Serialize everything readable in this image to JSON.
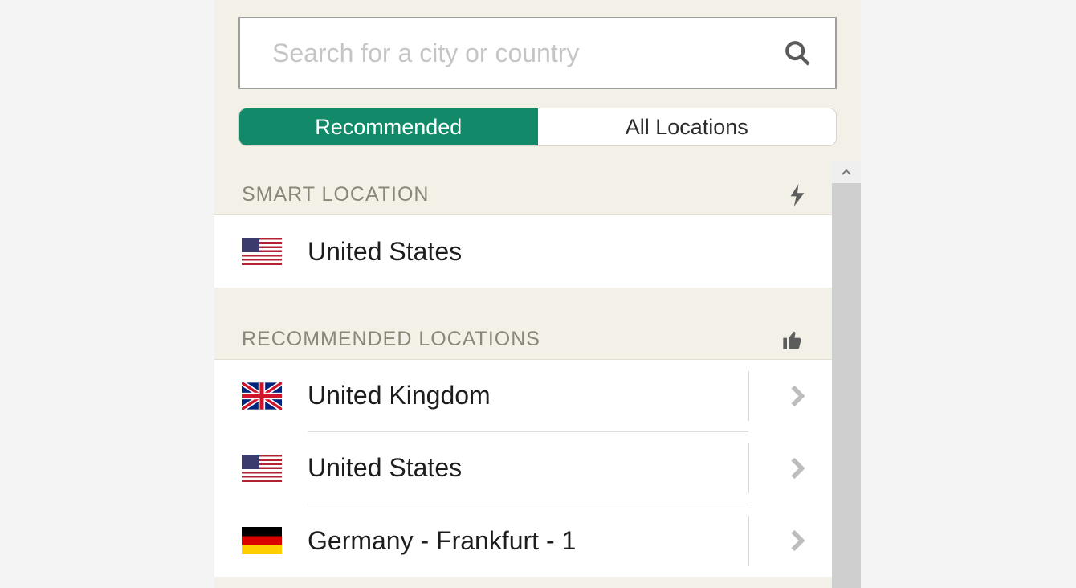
{
  "search": {
    "placeholder": "Search for a city or country"
  },
  "tabs": {
    "recommended": "Recommended",
    "all": "All Locations"
  },
  "sections": {
    "smart": "SMART LOCATION",
    "recommended": "RECOMMENDED LOCATIONS"
  },
  "smart_location": {
    "label": "United States",
    "flag": "us"
  },
  "recommended_locations": [
    {
      "label": "United Kingdom",
      "flag": "uk"
    },
    {
      "label": "United States",
      "flag": "us"
    },
    {
      "label": "Germany - Frankfurt - 1",
      "flag": "de"
    }
  ]
}
